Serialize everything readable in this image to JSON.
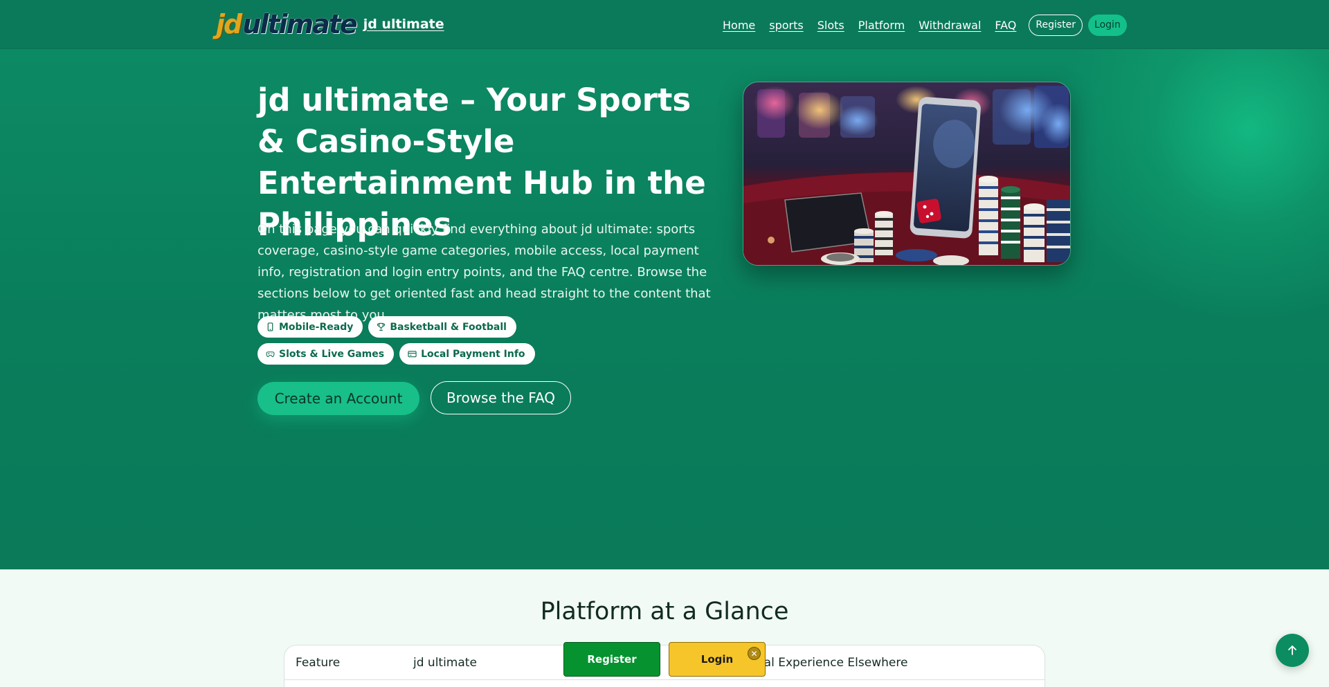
{
  "header": {
    "logo_mark_jd": "jd",
    "logo_mark_ultimate": "ultimate",
    "brand": "jd ultimate",
    "nav": [
      "Home",
      "sports",
      "Slots",
      "Platform",
      "Withdrawal",
      "FAQ"
    ],
    "register": "Register",
    "login": "Login"
  },
  "hero": {
    "title": "jd ultimate – Your Sports & Casino-Style Entertainment Hub in the Philippines",
    "description": "On this page you can quickly find everything about jd ultimate: sports coverage, casino-style game categories, mobile access, local payment info, registration and login entry points, and the FAQ centre. Browse the sections below to get oriented fast and head straight to the content that matters most to you.",
    "chips": [
      {
        "icon": "mobile-icon",
        "label": "Mobile-Ready"
      },
      {
        "icon": "trophy-icon",
        "label": "Basketball & Football"
      },
      {
        "icon": "gamepad-icon",
        "label": "Slots & Live Games"
      },
      {
        "icon": "card-icon",
        "label": "Local Payment Info"
      }
    ],
    "cta_primary": "Create an Account",
    "cta_secondary": "Browse the FAQ"
  },
  "glance": {
    "title": "Platform at a Glance",
    "columns": [
      "Feature",
      "jd ultimate",
      "Typical Experience Elsewhere"
    ]
  },
  "floating": {
    "register": "Register",
    "login": "Login",
    "close": "✕",
    "back_to_top": "↑"
  },
  "colors": {
    "header_bg": "#0b7a5a",
    "hero_bg": "#0a7d5b",
    "accent": "#18bf88",
    "float_register": "#06932f",
    "float_login": "#f6c52a"
  }
}
